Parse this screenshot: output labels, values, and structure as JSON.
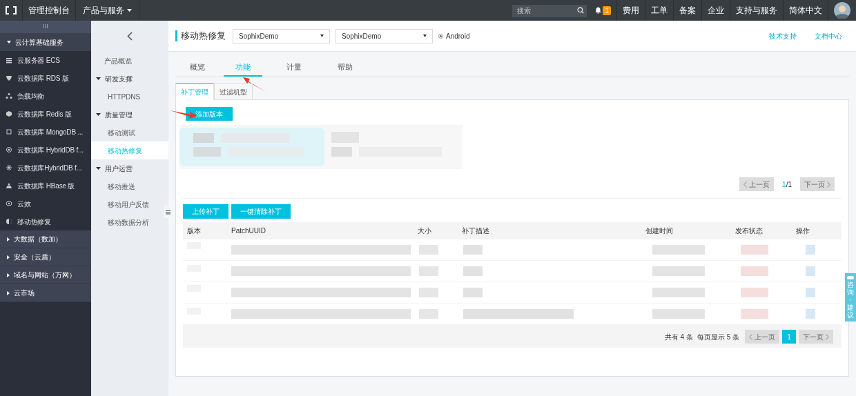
{
  "topbar": {
    "console": "管理控制台",
    "products": "产品与服务",
    "search": {
      "placeholder": "搜索"
    },
    "notifications": "1",
    "links": [
      "费用",
      "工单",
      "备案",
      "企业",
      "支持与服务",
      "简体中文"
    ]
  },
  "sidebar": {
    "toggle": "III",
    "groups": [
      {
        "label": "云计算基础服务",
        "expanded": true,
        "children": [
          {
            "label": "云服务器 ECS"
          },
          {
            "label": "云数据库 RDS 版"
          },
          {
            "label": "负载均衡"
          },
          {
            "label": "云数据库 Redis 版"
          },
          {
            "label": "云数据库 MongoDB ..."
          },
          {
            "label": "云数据库 HybridDB f..."
          },
          {
            "label": "云数据库HybridDB f..."
          },
          {
            "label": "云数据库 HBase 版"
          },
          {
            "label": "云效"
          },
          {
            "label": "移动热修复"
          }
        ]
      },
      {
        "label": "大数据（数加）",
        "expanded": false
      },
      {
        "label": "安全（云盾）",
        "expanded": false
      },
      {
        "label": "域名与网站（万网）",
        "expanded": false
      },
      {
        "label": "云市场",
        "expanded": false
      }
    ]
  },
  "subnav": [
    {
      "kind": "item",
      "label": "产品概览",
      "selected": false
    },
    {
      "kind": "group",
      "label": "研发支撑"
    },
    {
      "kind": "item",
      "label": "HTTPDNS",
      "selected": false
    },
    {
      "kind": "group",
      "label": "质量管理"
    },
    {
      "kind": "item",
      "label": "移动测试",
      "selected": false
    },
    {
      "kind": "item",
      "label": "移动热修复",
      "selected": true
    },
    {
      "kind": "group",
      "label": "用户运营"
    },
    {
      "kind": "item",
      "label": "移动推送",
      "selected": false
    },
    {
      "kind": "item",
      "label": "移动用户反馈",
      "selected": false
    },
    {
      "kind": "item",
      "label": "移动数据分析",
      "selected": false
    }
  ],
  "header": {
    "title": "移动热修复",
    "selects": [
      "SophixDemo",
      "SophixDemo"
    ],
    "platform": {
      "label": "Android",
      "selected": true
    },
    "links": [
      "技术支持",
      "文档中心"
    ]
  },
  "tabs": [
    {
      "label": "概览",
      "selected": false
    },
    {
      "label": "功能",
      "selected": true
    },
    {
      "label": "计量",
      "selected": false
    },
    {
      "label": "帮助",
      "selected": false
    }
  ],
  "subtabs": [
    {
      "label": "补丁管理",
      "selected": true
    },
    {
      "label": "过滤机型",
      "selected": false
    }
  ],
  "add_button": "添加版本",
  "version_pager": {
    "prev": "上一页",
    "page": "1",
    "total": "/1",
    "next": "下一页"
  },
  "actions": [
    "上传补丁",
    "一键清除补丁"
  ],
  "table": {
    "columns": [
      "版本",
      "PatchUUID",
      "大小",
      "补丁描述",
      "创建时间",
      "发布状态",
      "操作"
    ]
  },
  "footer": {
    "total": "共有 4 条",
    "per_page": "每页显示 5 条",
    "prev": "上一页",
    "pages": [
      {
        "label": "1",
        "selected": true
      }
    ],
    "next": "下一页"
  },
  "feedback_tab": "咨询·建议"
}
